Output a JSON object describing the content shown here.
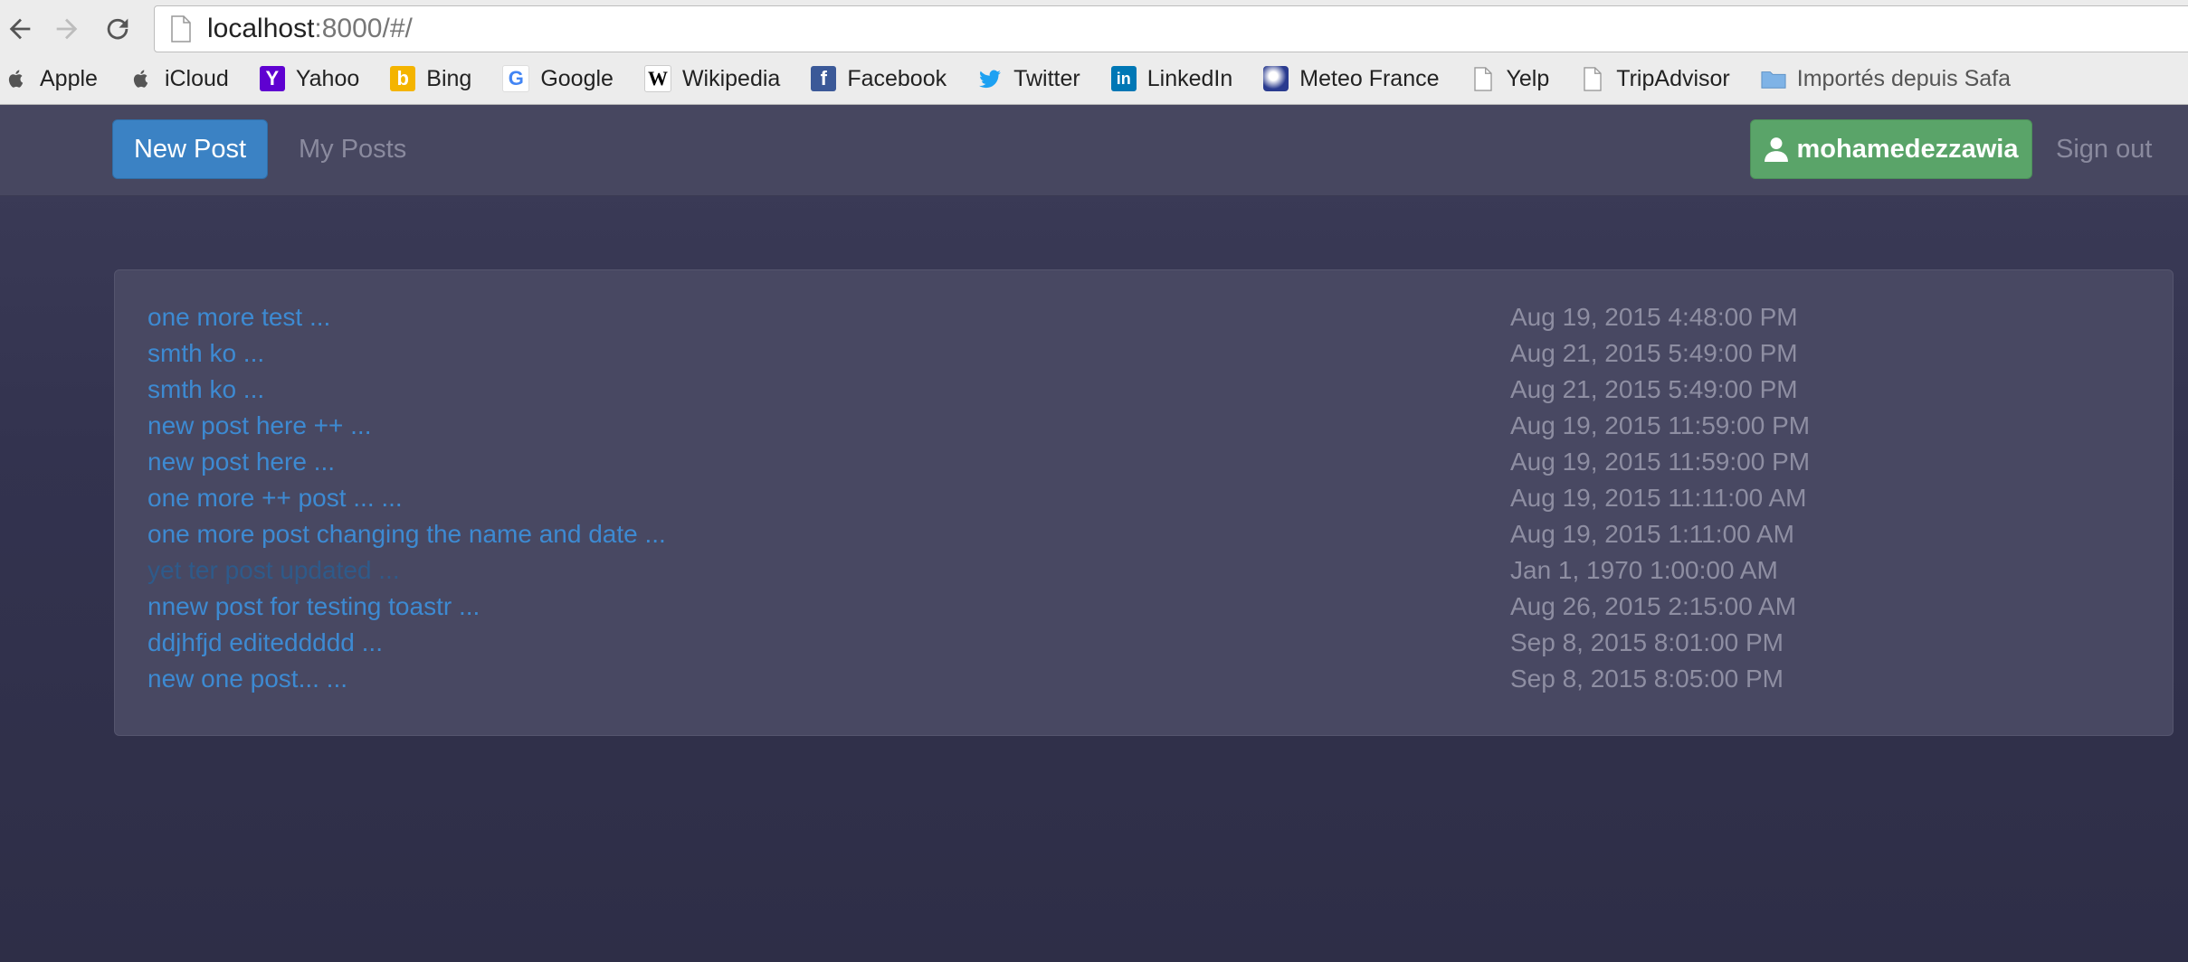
{
  "browser": {
    "url_host": "localhost",
    "url_rest": ":8000/#/",
    "bookmarks": [
      {
        "label": "Apple",
        "icon": "apple-icon"
      },
      {
        "label": "iCloud",
        "icon": "apple-icon"
      },
      {
        "label": "Yahoo",
        "icon": "yahoo-icon"
      },
      {
        "label": "Bing",
        "icon": "bing-icon"
      },
      {
        "label": "Google",
        "icon": "google-icon"
      },
      {
        "label": "Wikipedia",
        "icon": "wikipedia-icon"
      },
      {
        "label": "Facebook",
        "icon": "facebook-icon"
      },
      {
        "label": "Twitter",
        "icon": "twitter-icon"
      },
      {
        "label": "LinkedIn",
        "icon": "linkedin-icon"
      },
      {
        "label": "Meteo France",
        "icon": "meteo-icon"
      },
      {
        "label": "Yelp",
        "icon": "page-icon"
      },
      {
        "label": "TripAdvisor",
        "icon": "page-icon"
      },
      {
        "label": "Importés depuis Safa",
        "icon": "folder-icon"
      }
    ]
  },
  "nav": {
    "new_post": "New Post",
    "my_posts": "My Posts",
    "username": "mohamedezzawia",
    "sign_out": "Sign out"
  },
  "posts": [
    {
      "title": "one more test ...",
      "date": "Aug 19, 2015 4:48:00 PM"
    },
    {
      "title": "smth ko ...",
      "date": "Aug 21, 2015 5:49:00 PM"
    },
    {
      "title": "smth ko ...",
      "date": "Aug 21, 2015 5:49:00 PM"
    },
    {
      "title": "new post here ++ ...",
      "date": "Aug 19, 2015 11:59:00 PM"
    },
    {
      "title": "new post here ...",
      "date": "Aug 19, 2015 11:59:00 PM"
    },
    {
      "title": "one more ++ post ... ...",
      "date": "Aug 19, 2015 11:11:00 AM"
    },
    {
      "title": "one more post changing the name and date ...",
      "date": "Aug 19, 2015 1:11:00 AM"
    },
    {
      "title": "yet ter post updated ...",
      "date": "Jan 1, 1970 1:00:00 AM"
    },
    {
      "title": "nnew post for testing toastr ...",
      "date": "Aug 26, 2015 2:15:00 AM"
    },
    {
      "title": "ddjhfjd editeddddd ...",
      "date": "Sep 8, 2015 8:01:00 PM"
    },
    {
      "title": "new one post... ...",
      "date": "Sep 8, 2015 8:05:00 PM"
    }
  ],
  "colors": {
    "primary": "#3b82c4",
    "success": "#5aa469",
    "link": "#3d8ad2",
    "background": "#33334d"
  }
}
